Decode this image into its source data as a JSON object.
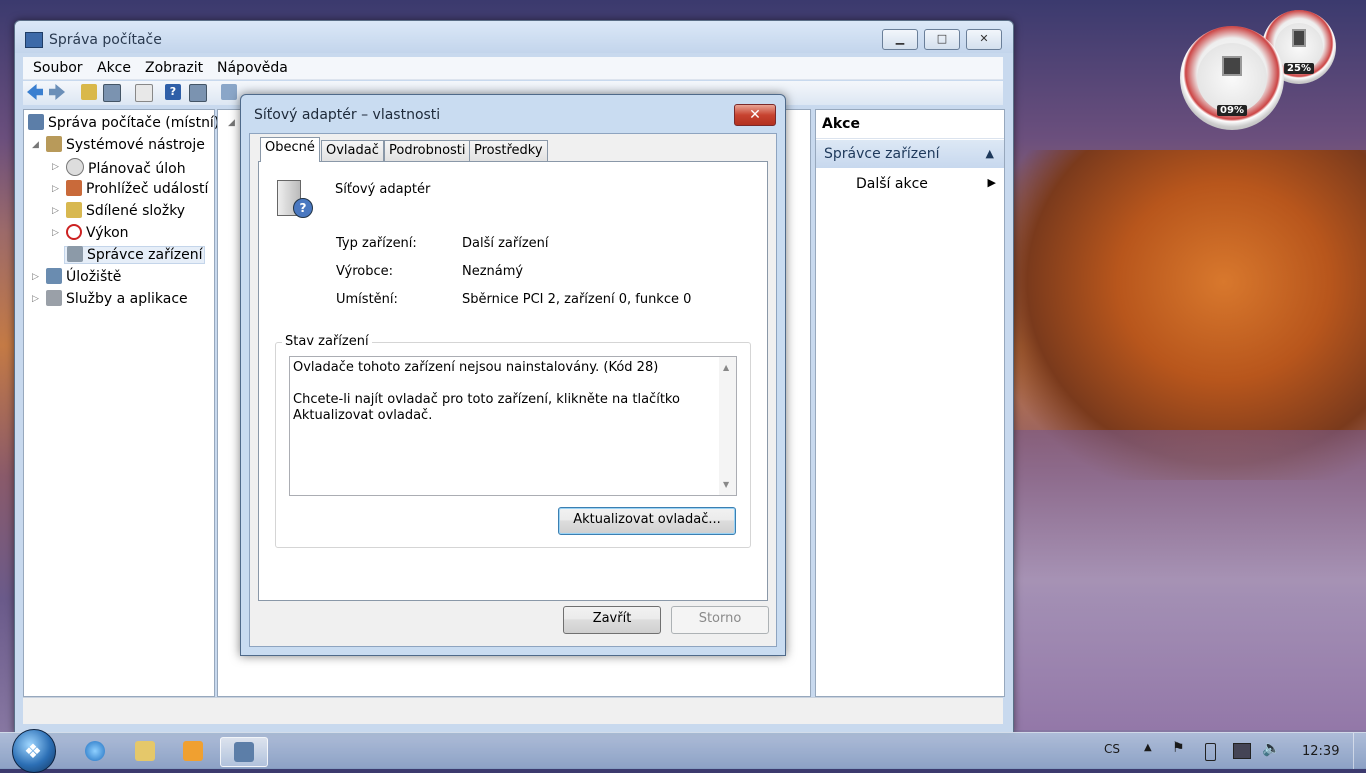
{
  "main_window": {
    "title": "Správa počítače",
    "controls": {
      "minimize": "▁",
      "maximize": "□",
      "close": "✕"
    },
    "menu": [
      "Soubor",
      "Akce",
      "Zobrazit",
      "Nápověda"
    ],
    "tree": {
      "root": "Správa počítače (místní)",
      "system_tools": "Systémové nástroje",
      "task_scheduler": "Plánovač úloh",
      "event_viewer": "Prohlížeč událostí",
      "shared_folders": "Sdílené složky",
      "performance": "Výkon",
      "device_manager": "Správce zařízení",
      "storage": "Úložiště",
      "services": "Služby a aplikace"
    },
    "actions": {
      "header": "Akce",
      "section": "Správce zařízení",
      "more": "Další akce"
    }
  },
  "dialog": {
    "title": "Síťový adaptér – vlastnosti",
    "close": "✕",
    "tabs": [
      "Obecné",
      "Ovladač",
      "Podrobnosti",
      "Prostředky"
    ],
    "device_name": "Síťový adaptér",
    "properties": {
      "type_label": "Typ zařízení:",
      "type_value": "Další zařízení",
      "manufacturer_label": "Výrobce:",
      "manufacturer_value": "Neznámý",
      "location_label": "Umístění:",
      "location_value": "Sběrnice PCI 2, zařízení 0, funkce 0"
    },
    "status_group": "Stav zařízení",
    "status_text": "Ovladače tohoto zařízení nejsou nainstalovány. (Kód 28)\n\nChcete-li najít ovladač pro toto zařízení, klikněte na tlačítko Aktualizovat ovladač.",
    "update_button": "Aktualizovat ovladač...",
    "close_button": "Zavřít",
    "cancel_button": "Storno"
  },
  "gadgets": {
    "cpu": "09%",
    "memory": "25%"
  },
  "taskbar": {
    "lang": "CS",
    "time": "12:39"
  }
}
